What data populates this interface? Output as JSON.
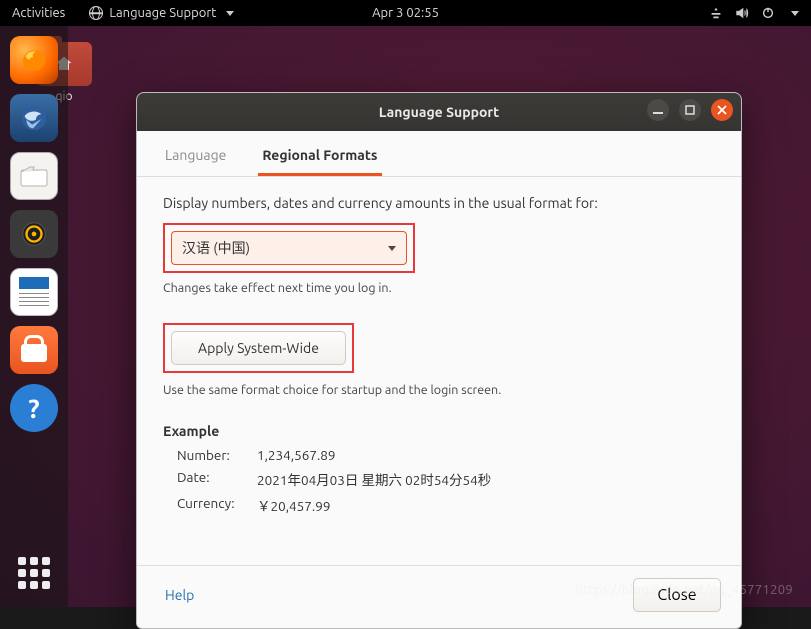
{
  "topbar": {
    "activities": "Activities",
    "app_indicator": "Language Support",
    "clock": "Apr 3  02:55"
  },
  "desktop_folder_label": "qio",
  "dialog": {
    "title": "Language Support",
    "tabs": {
      "language": "Language",
      "regional": "Regional Formats"
    },
    "description": "Display numbers, dates and currency amounts in the usual format for:",
    "locale_selected": "汉语 (中国)",
    "changes_note": "Changes take effect next time you log in.",
    "apply_label": "Apply System-Wide",
    "apply_note": "Use the same format choice for startup and the login screen.",
    "example": {
      "heading": "Example",
      "number_label": "Number:",
      "number_value": "1,234,567.89",
      "date_label": "Date:",
      "date_value": "2021年04月03日 星期六 02时54分54秒",
      "currency_label": "Currency:",
      "currency_value": "￥20,457.99"
    },
    "help": "Help",
    "close": "Close"
  },
  "watermark": "https://blog.csdn.net/qq_45771209"
}
